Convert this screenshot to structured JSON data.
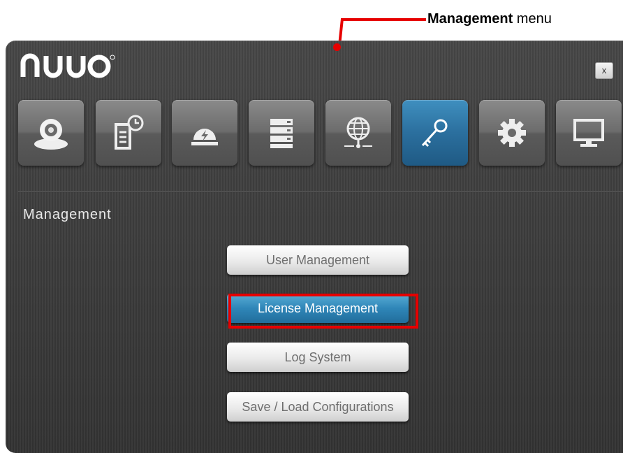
{
  "annotation": {
    "bold_text": "Management",
    "text": " menu",
    "color": "#e60000"
  },
  "window": {
    "brand": "NUUO",
    "close_label": "x"
  },
  "toolbar": {
    "items": [
      {
        "name": "camera",
        "icon": "camera-icon",
        "active": false
      },
      {
        "name": "schedule",
        "icon": "schedule-icon",
        "active": false
      },
      {
        "name": "event",
        "icon": "event-alert-icon",
        "active": false
      },
      {
        "name": "storage",
        "icon": "storage-icon",
        "active": false
      },
      {
        "name": "network",
        "icon": "network-icon",
        "active": false
      },
      {
        "name": "management",
        "icon": "key-icon",
        "active": true
      },
      {
        "name": "settings",
        "icon": "gear-icon",
        "active": false
      },
      {
        "name": "display",
        "icon": "monitor-icon",
        "active": false
      }
    ]
  },
  "section": {
    "title": "Management"
  },
  "menu": {
    "user_management": "User Management",
    "license_management": "License Management",
    "log_system": "Log System",
    "save_load": "Save / Load Configurations",
    "active_item": "License Management"
  },
  "colors": {
    "accent": "#2b6f9e",
    "highlight": "#e60000",
    "background": "#3e3e3e"
  }
}
